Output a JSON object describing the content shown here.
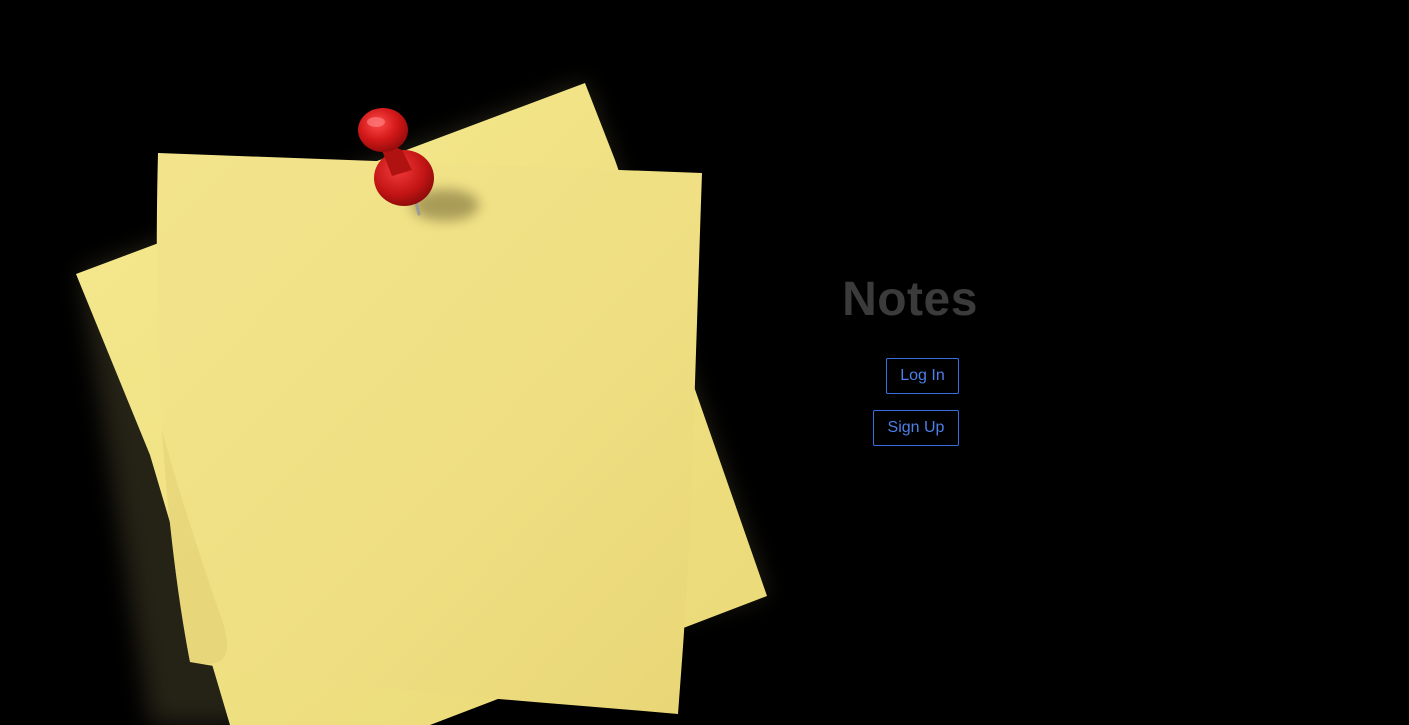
{
  "app": {
    "title": "Notes"
  },
  "actions": {
    "login_label": "Log In",
    "signup_label": "Sign Up"
  },
  "colors": {
    "background": "#000000",
    "title": "#3b3b3b",
    "button_accent": "#4d7fe8",
    "note_paper": "#f2e48a",
    "pin": "#c81a1a"
  },
  "illustration": {
    "icon": "sticky-note-with-pushpin"
  }
}
